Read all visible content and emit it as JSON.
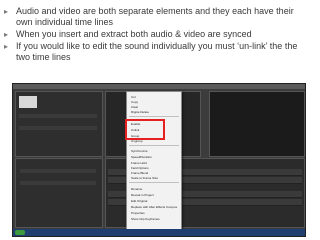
{
  "bullets": [
    "Audio and video are both separate elements and they each have their own individual time lines",
    "When you insert and extract both audio & video are synced",
    "If you would like to edit the sound individually you must ‘un-link’ the the two time lines"
  ],
  "screenshot": {
    "context_menu": {
      "items": [
        "Cut",
        "Copy",
        "Clear",
        "Ripple Delete",
        "",
        "Enable",
        "Unlink",
        "Group",
        "Ungroup",
        "Synchronize",
        "Speed/Duration",
        "Frame Hold",
        "Field Options",
        "Frame Blend",
        "Scale to Frame Size",
        "Rename",
        "Reveal in Project",
        "Edit Original",
        "Replace with After Effects Composition",
        "Properties",
        "Show Clip Keyframes"
      ]
    },
    "colors": {
      "highlight": "#e52020"
    },
    "icons": [
      "bullet-arrow-icon"
    ]
  }
}
